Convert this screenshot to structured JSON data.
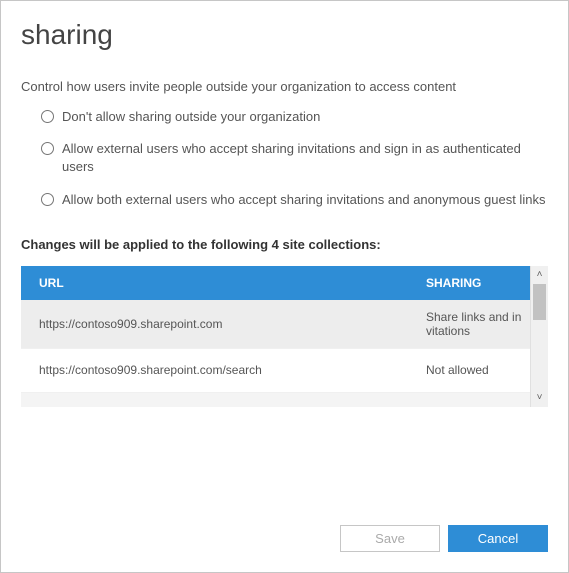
{
  "title": "sharing",
  "description": "Control how users invite people outside your organization to access content",
  "options": [
    "Don't allow sharing outside your organization",
    "Allow external users who accept sharing invitations and sign in as authenticated users",
    "Allow both external users who accept sharing invitations and anonymous guest links"
  ],
  "changes_label": "Changes will be applied to the following 4 site collections:",
  "table": {
    "headers": {
      "url": "URL",
      "sharing": "SHARING"
    },
    "rows": [
      {
        "url": "https://contoso909.sharepoint.com",
        "sharing": "Share links and invitations"
      },
      {
        "url": "https://contoso909.sharepoint.com/search",
        "sharing": "Not allowed"
      }
    ]
  },
  "buttons": {
    "save": "Save",
    "cancel": "Cancel"
  },
  "scroll": {
    "up": "˄",
    "down": "˅"
  }
}
